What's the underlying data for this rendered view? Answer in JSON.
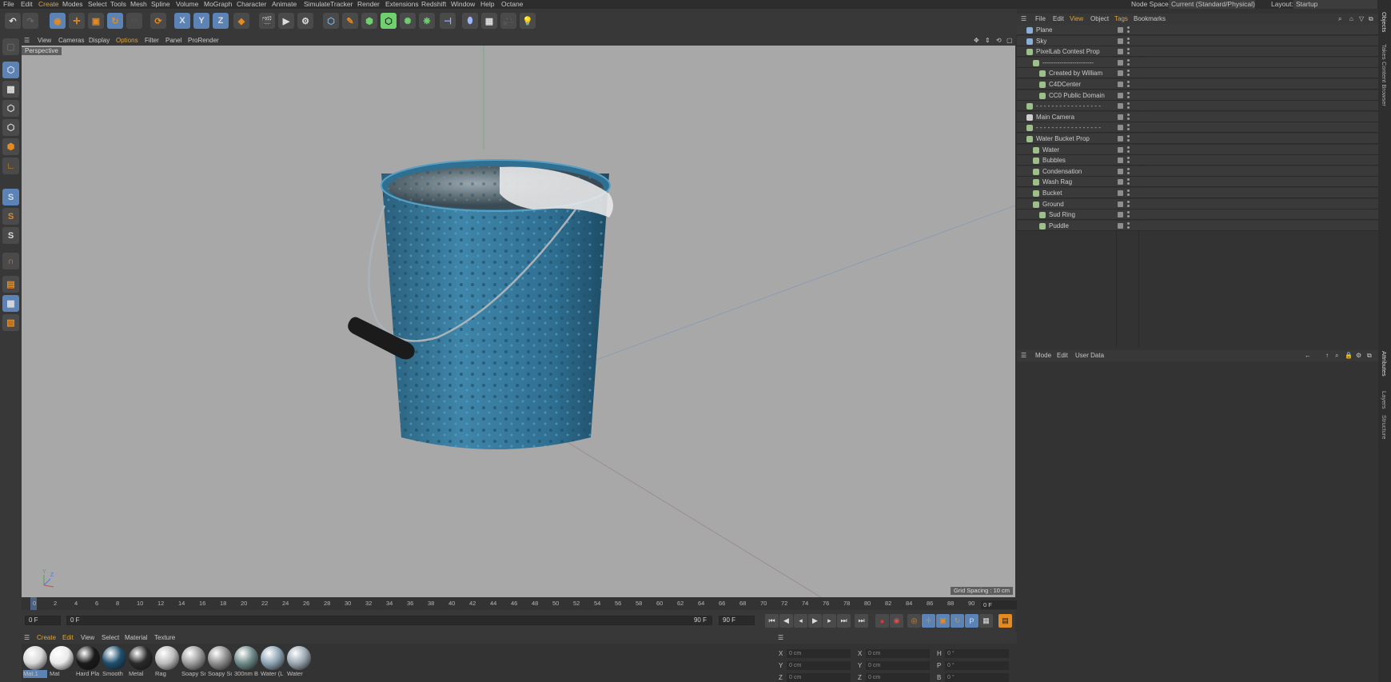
{
  "menubar": {
    "items": [
      "File",
      "Edit",
      "Create",
      "Modes",
      "Select",
      "Tools",
      "Mesh",
      "Spline",
      "Volume",
      "MoGraph",
      "Character",
      "Animate",
      "Simulate",
      "Tracker",
      "Render",
      "Extensions",
      "Redshift",
      "Window",
      "Help",
      "Octane"
    ],
    "node_space_label": "Node Space:",
    "node_space_value": "Current (Standard/Physical)",
    "layout_label": "Layout:",
    "layout_value": "Startup"
  },
  "toolbar": {
    "axis_x": "X",
    "axis_y": "Y",
    "axis_z": "Z"
  },
  "left_tools": {
    "snap_s1": "S",
    "snap_s2": "S",
    "snap_s3": "S"
  },
  "viewport_menu": {
    "items": [
      "View",
      "Cameras",
      "Display",
      "Options",
      "Filter",
      "Panel",
      "ProRender"
    ],
    "active": "Options",
    "camera_label": "Perspective",
    "grid_spacing": "Grid Spacing : 10 cm",
    "axis_y": "Y",
    "axis_z": "Z"
  },
  "timeline": {
    "ticks": [
      "0",
      "2",
      "4",
      "6",
      "8",
      "10",
      "12",
      "14",
      "16",
      "18",
      "20",
      "22",
      "24",
      "26",
      "28",
      "30",
      "32",
      "34",
      "36",
      "38",
      "40",
      "42",
      "44",
      "46",
      "48",
      "50",
      "52",
      "54",
      "56",
      "58",
      "60",
      "62",
      "64",
      "66",
      "68",
      "70",
      "72",
      "74",
      "76",
      "78",
      "80",
      "82",
      "84",
      "86",
      "88",
      "90"
    ],
    "current_frame": "0 F"
  },
  "transport": {
    "start_field": "0 F",
    "offset_field": "0 F",
    "end_field_a": "90 F",
    "end_field_b": "90 F",
    "record_p_label": "P"
  },
  "materials_menu": {
    "items": [
      "Create",
      "Edit",
      "View",
      "Select",
      "Material",
      "Texture"
    ],
    "active": "Create"
  },
  "materials": [
    {
      "name": "Mat.1",
      "color": "#d8d8d8"
    },
    {
      "name": "Mat",
      "color": "#eaeaea"
    },
    {
      "name": "Hard Pla",
      "color": "#1a1a1a"
    },
    {
      "name": "Smooth",
      "color": "#1f4f6e"
    },
    {
      "name": "Metal",
      "color": "#2a2a2a"
    },
    {
      "name": "Rag",
      "color": "#bdbdbd"
    },
    {
      "name": "Soapy Sr",
      "color": "#9d9d9d"
    },
    {
      "name": "Soapy Sc",
      "color": "#8f8f8f"
    },
    {
      "name": "300nm B",
      "color": "#6f8a8a"
    },
    {
      "name": "Water (L",
      "color": "#8fa5b5"
    },
    {
      "name": "Water",
      "color": "#9aa8b2"
    }
  ],
  "coordinates": {
    "pos": {
      "x": "X",
      "y": "Y",
      "z": "Z",
      "xv": "0 cm",
      "yv": "0 cm",
      "zv": "0 cm"
    },
    "size": {
      "x": "X",
      "y": "Y",
      "z": "Z",
      "xv": "0 cm",
      "yv": "0 cm",
      "zv": "0 cm"
    },
    "rot": {
      "h": "H",
      "p": "P",
      "b": "B",
      "hv": "0 °",
      "pv": "0 °",
      "bv": "0 °"
    }
  },
  "object_menu": {
    "items": [
      "File",
      "Edit",
      "View",
      "Object",
      "Tags",
      "Bookmarks"
    ],
    "active": [
      "View",
      "Tags"
    ]
  },
  "objects": [
    {
      "name": "Plane",
      "indent": 0,
      "color": "#8ab0d8"
    },
    {
      "name": "Sky",
      "indent": 0,
      "color": "#8ab0d8"
    },
    {
      "name": "PixelLab Contest Prop",
      "indent": 0,
      "color": "#9dc08b"
    },
    {
      "name": "------------------------",
      "indent": 1,
      "color": "#9dc08b"
    },
    {
      "name": "Created by William",
      "indent": 2,
      "color": "#9dc08b"
    },
    {
      "name": "C4DCenter",
      "indent": 2,
      "color": "#9dc08b"
    },
    {
      "name": "CC0 Public Domain",
      "indent": 2,
      "color": "#9dc08b"
    },
    {
      "name": "- - - - - - - - - - - - - - - - -",
      "indent": 0,
      "color": "#9dc08b"
    },
    {
      "name": "Main Camera",
      "indent": 0,
      "color": "#cfcfcf"
    },
    {
      "name": "- - - - - - - - - - - - - - - - -",
      "indent": 0,
      "color": "#9dc08b"
    },
    {
      "name": "Water Bucket Prop",
      "indent": 0,
      "color": "#9dc08b"
    },
    {
      "name": "Water",
      "indent": 1,
      "color": "#9dc08b"
    },
    {
      "name": "Bubbles",
      "indent": 1,
      "color": "#9dc08b"
    },
    {
      "name": "Condensation",
      "indent": 1,
      "color": "#9dc08b"
    },
    {
      "name": "Wash Rag",
      "indent": 1,
      "color": "#9dc08b"
    },
    {
      "name": "Bucket",
      "indent": 1,
      "color": "#9dc08b"
    },
    {
      "name": "Ground",
      "indent": 1,
      "color": "#9dc08b"
    },
    {
      "name": "Sud Ring",
      "indent": 2,
      "color": "#9dc08b"
    },
    {
      "name": "Puddle",
      "indent": 2,
      "color": "#9dc08b"
    }
  ],
  "attributes_menu": {
    "items": [
      "Mode",
      "Edit",
      "User Data"
    ]
  },
  "right_tabs": {
    "top": [
      "Objects",
      "Takes",
      "Content Browser"
    ],
    "bottom": [
      "Attributes",
      "Layers",
      "Structure"
    ]
  }
}
